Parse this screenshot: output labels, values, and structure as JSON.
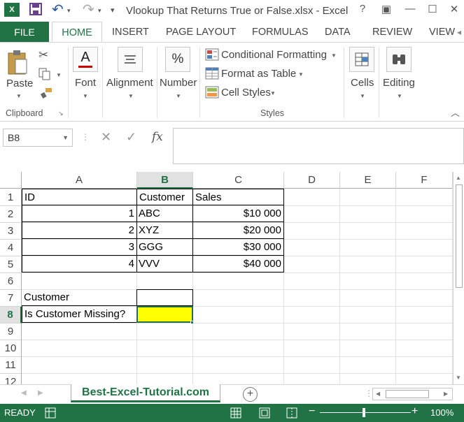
{
  "window": {
    "title": "Vlookup That Returns True or False.xlsx - Excel",
    "help": "?",
    "ribbon_display": "▣",
    "minimize": "—",
    "maximize": "☐",
    "close": "✕"
  },
  "qat": {
    "undo": "↶",
    "redo": "↷",
    "customize": "▾"
  },
  "tabs": [
    "FILE",
    "HOME",
    "INSERT",
    "PAGE LAYOUT",
    "FORMULAS",
    "DATA",
    "REVIEW",
    "VIEW"
  ],
  "ribbon": {
    "clipboard": {
      "paste": "Paste",
      "group": "Clipboard"
    },
    "font": "Font",
    "alignment": "Alignment",
    "number": "Number",
    "styles": {
      "conditional": "Conditional Formatting",
      "format_table": "Format as Table",
      "cell_styles": "Cell Styles",
      "group": "Styles"
    },
    "cells": "Cells",
    "editing": "Editing",
    "font_icon_glyph": "A",
    "number_icon_glyph": "%",
    "collapse_glyph": "︿"
  },
  "formula_bar": {
    "name_box": "B8",
    "cancel": "✕",
    "enter": "✓",
    "fx": "fx",
    "value": ""
  },
  "columns": [
    "A",
    "B",
    "C",
    "D",
    "E",
    "F"
  ],
  "rows": [
    "1",
    "2",
    "3",
    "4",
    "5",
    "6",
    "7",
    "8",
    "9",
    "10",
    "11",
    "12"
  ],
  "cells": {
    "A1": "ID",
    "B1": "Customer",
    "C1": "Sales",
    "A2": "1",
    "B2": "ABC",
    "C2": "$10 000",
    "A3": "2",
    "B3": "XYZ",
    "C3": "$20 000",
    "A4": "3",
    "B4": "GGG",
    "C4": "$30 000",
    "A5": "4",
    "B5": "VVV",
    "C5": "$40 000",
    "A7": "Customer",
    "A8": "Is Customer Missing?"
  },
  "colors": {
    "accent": "#217346",
    "highlight": "#ffff00"
  },
  "sheet": {
    "tab": "Best-Excel-Tutorial.com",
    "add": "+"
  },
  "status": {
    "ready": "READY",
    "zoom": "100%",
    "zoom_minus": "−",
    "zoom_plus": "+"
  }
}
